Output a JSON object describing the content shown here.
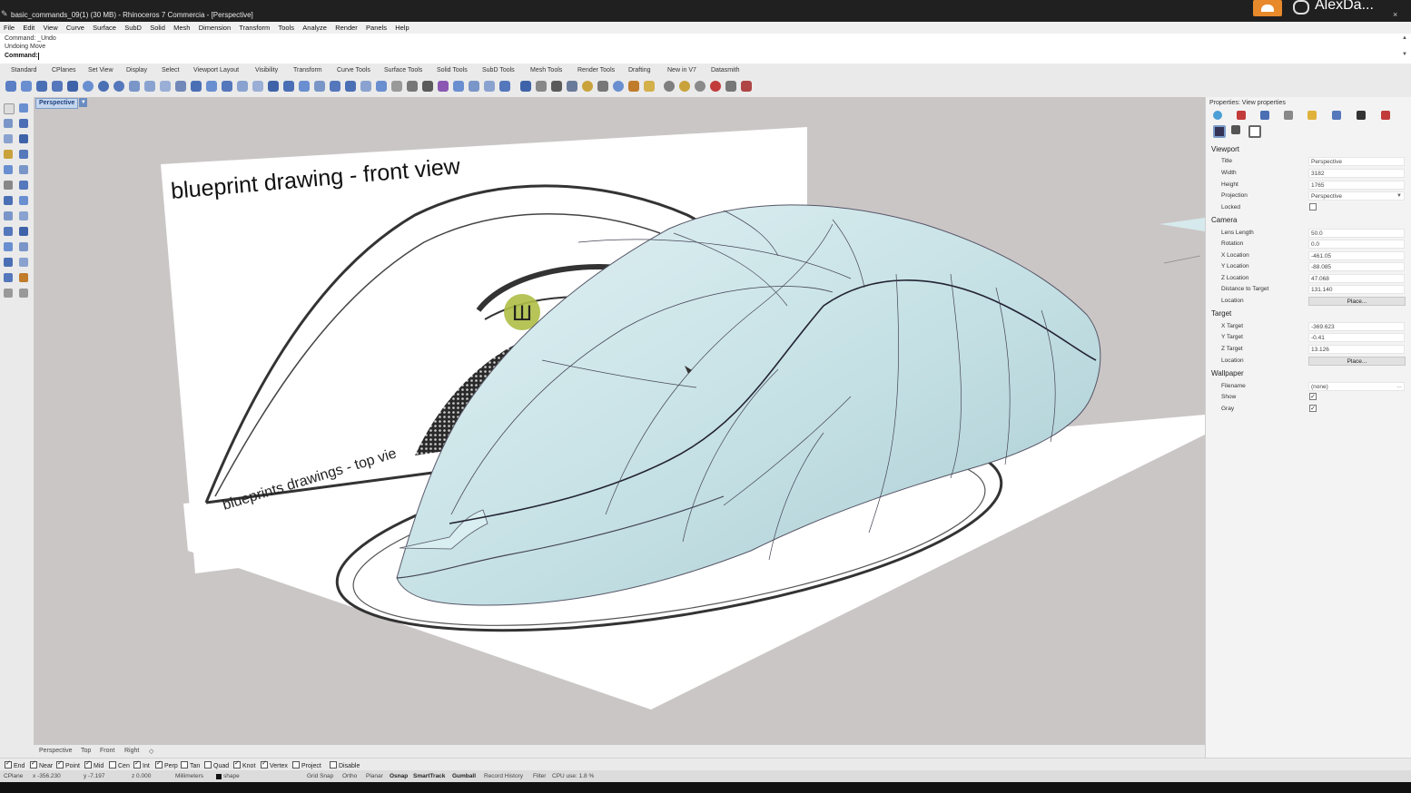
{
  "window": {
    "title": "basic_commands_09(1) (30 MB) - Rhinoceros 7 Commercia - [Perspective]"
  },
  "streamer": {
    "name": "AlexDa...",
    "close": "×"
  },
  "menu": [
    "File",
    "Edit",
    "View",
    "Curve",
    "Surface",
    "SubD",
    "Solid",
    "Mesh",
    "Dimension",
    "Transform",
    "Tools",
    "Analyze",
    "Render",
    "Panels",
    "Help"
  ],
  "command": {
    "history1": "Command: _Undo",
    "history2": "Undoing Move",
    "prompt": "Command:"
  },
  "toolbar_tabs": [
    "Standard",
    "CPlanes",
    "Set View",
    "Display",
    "Select",
    "Viewport Layout",
    "Visibility",
    "Transform",
    "Curve Tools",
    "Surface Tools",
    "Solid Tools",
    "SubD Tools",
    "Mesh Tools",
    "Render Tools",
    "Drafting",
    "New in V7",
    "Datasmith"
  ],
  "viewport": {
    "label": "Perspective",
    "front_text": "blueprint drawing - front view",
    "top_text": "blueprints drawings - top vie",
    "badge": "Ш",
    "colors": {
      "background": "#cbc6c6",
      "surface": "#cfe6e9",
      "sheet": "#ffffff"
    }
  },
  "view_tabs": [
    "Perspective",
    "Top",
    "Front",
    "Right",
    "◇"
  ],
  "osnaps": [
    {
      "label": "End",
      "checked": true
    },
    {
      "label": "Near",
      "checked": true
    },
    {
      "label": "Point",
      "checked": true
    },
    {
      "label": "Mid",
      "checked": true
    },
    {
      "label": "Cen",
      "checked": false
    },
    {
      "label": "Int",
      "checked": true
    },
    {
      "label": "Perp",
      "checked": true
    },
    {
      "label": "Tan",
      "checked": false
    },
    {
      "label": "Quad",
      "checked": false
    },
    {
      "label": "Knot",
      "checked": true
    },
    {
      "label": "Vertex",
      "checked": true
    },
    {
      "label": "Project",
      "checked": false
    },
    {
      "label": "Disable",
      "checked": false
    }
  ],
  "status": {
    "cplane": "CPlane",
    "x": "x -356.230",
    "y": "y -7.197",
    "z": "z 0.000",
    "units": "Millimeters",
    "layer": "shape",
    "grid_snap": "Grid Snap",
    "ortho": "Ortho",
    "planar": "Planar",
    "osnap": "Osnap",
    "smarttrack": "SmartTrack",
    "gumball": "Gumball",
    "record_history": "Record History",
    "filter": "Filter",
    "cpu": "CPU use: 1.8 %"
  },
  "properties": {
    "header": "Properties: View properties",
    "viewport": {
      "section": "Viewport",
      "title_label": "Title",
      "title": "Perspective",
      "width_label": "Width",
      "width": "3182",
      "height_label": "Height",
      "height": "1765",
      "projection_label": "Projection",
      "projection": "Perspective",
      "locked_label": "Locked",
      "locked": false
    },
    "camera": {
      "section": "Camera",
      "lens_label": "Lens Length",
      "lens": "50.0",
      "rotation_label": "Rotation",
      "rotation": "0.0",
      "xloc_label": "X Location",
      "xloc": "-461.05",
      "yloc_label": "Y Location",
      "yloc": "-88.085",
      "zloc_label": "Z Location",
      "zloc": "47.068",
      "dist_label": "Distance to Target",
      "dist": "131.140",
      "location_label": "Location",
      "place": "Place..."
    },
    "target": {
      "section": "Target",
      "x_label": "X Target",
      "x": "-369.623",
      "y_label": "Y Target",
      "y": "-0.41",
      "z_label": "Z Target",
      "z": "13.126",
      "location_label": "Location",
      "place": "Place..."
    },
    "wallpaper": {
      "section": "Wallpaper",
      "filename_label": "Filename",
      "filename": "(none)",
      "show_label": "Show",
      "show": true,
      "gray_label": "Gray",
      "gray": true
    }
  }
}
